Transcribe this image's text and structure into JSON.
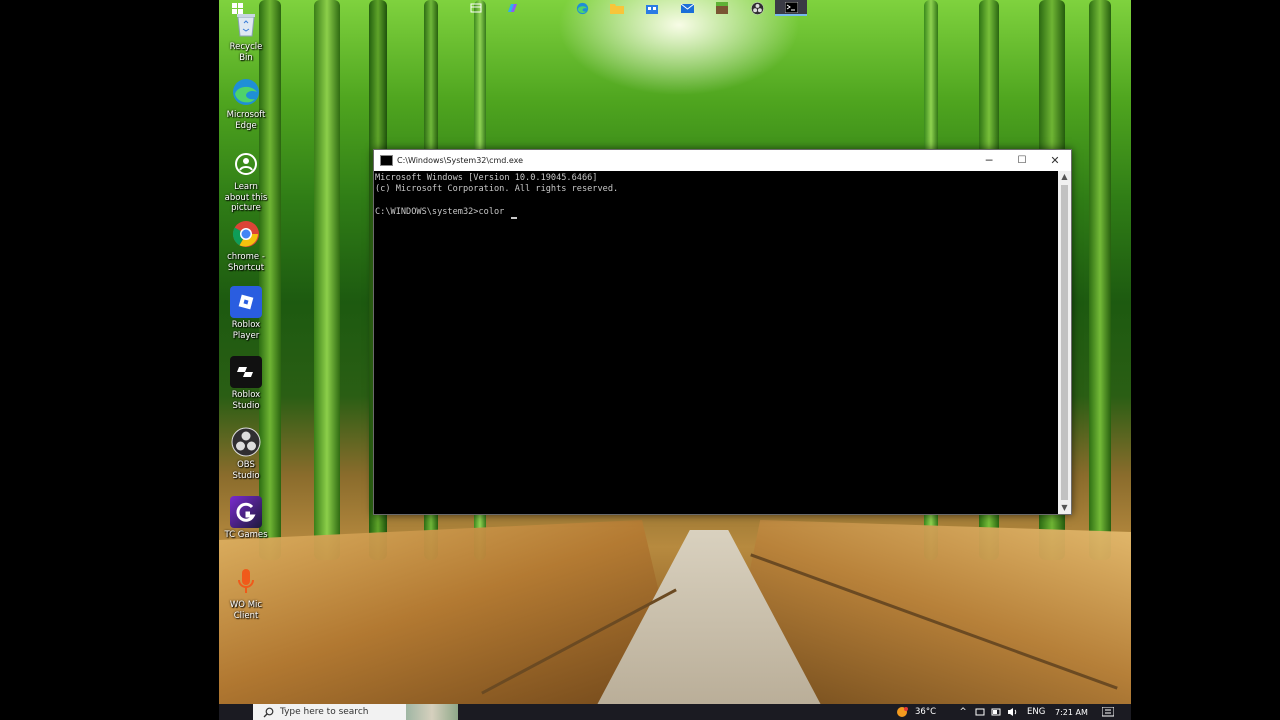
{
  "desktop": {
    "icons": [
      {
        "label": "Recycle Bin",
        "icon": "recycle-bin-icon"
      },
      {
        "label": "Microsoft Edge",
        "icon": "edge-icon"
      },
      {
        "label": "Learn about this picture",
        "icon": "learn-picture-icon"
      },
      {
        "label": "chrome - Shortcut",
        "icon": "chrome-icon"
      },
      {
        "label": "Roblox Player",
        "icon": "roblox-player-icon"
      },
      {
        "label": "Roblox Studio",
        "icon": "roblox-studio-icon"
      },
      {
        "label": "OBS Studio",
        "icon": "obs-icon"
      },
      {
        "label": "TC Games",
        "icon": "tc-games-icon"
      },
      {
        "label": "WO Mic Client",
        "icon": "microphone-icon"
      }
    ]
  },
  "cmd_window": {
    "title": "C:\\Windows\\System32\\cmd.exe",
    "minimize": "─",
    "maximize": "☐",
    "close": "✕",
    "lines": [
      "Microsoft Windows [Version 10.0.19045.6466]",
      "(c) Microsoft Corporation. All rights reserved.",
      "",
      "C:\\WINDOWS\\system32>color "
    ]
  },
  "taskbar": {
    "search_placeholder": "Type here to search",
    "weather": "36°C",
    "language": "ENG",
    "time": "7:21 AM"
  },
  "colors": {
    "console_bg": "#000000",
    "console_fg": "#c8c8c8",
    "taskbar_bg": "#1b1b22"
  }
}
